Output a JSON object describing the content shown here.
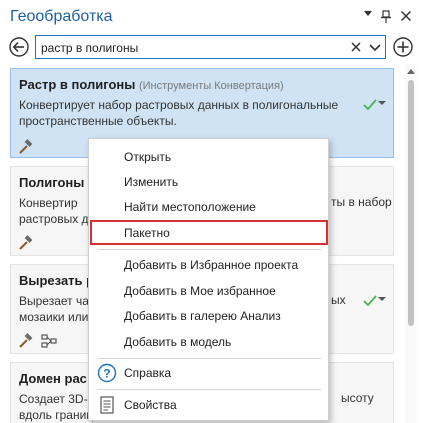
{
  "pane": {
    "title": "Геообработка"
  },
  "search": {
    "value": "растр в полигоны"
  },
  "results": [
    {
      "title": "Растр в полигоны",
      "toolbox": "(Инструменты Конвертация)",
      "description": "Конвертирует набор растровых данных в полигональные пространственные объекты.",
      "selected": true
    },
    {
      "title": "Полигоны",
      "description_left": "Конвертир",
      "description_left2": "растровых д",
      "description_right": "ты в набор"
    },
    {
      "title": "Вырезать р",
      "description_left": "Вырезает час",
      "description_left2": "мозаики или",
      "description_right": "ых"
    },
    {
      "title": "Домен рас",
      "description_left": "Создает 3D-г",
      "description_left2": "вдоль границ",
      "description_right": "ысоту"
    }
  ],
  "context_menu": {
    "items": [
      {
        "label": "Открыть"
      },
      {
        "label": "Изменить"
      },
      {
        "label": "Найти местоположение"
      },
      {
        "label": "Пакетно"
      },
      {
        "label": "Добавить в Избранное проекта"
      },
      {
        "label": "Добавить в Мое избранное"
      },
      {
        "label": "Добавить в галерею Анализ"
      },
      {
        "label": "Добавить в модель"
      },
      {
        "label": "Справка",
        "icon": "help-icon"
      },
      {
        "label": "Свойства",
        "icon": "properties-icon"
      }
    ]
  },
  "colors": {
    "accent": "#1e73be",
    "selection": "#cfe3f5",
    "highlight": "#d62f35",
    "check": "#4caf50"
  }
}
